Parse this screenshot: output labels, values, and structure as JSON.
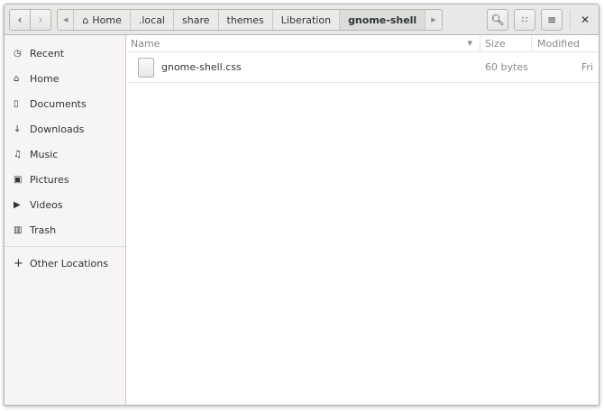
{
  "breadcrumbs": [
    "Home",
    ".local",
    "share",
    "themes",
    "Liberation",
    "gnome-shell"
  ],
  "sidebar": {
    "items": [
      {
        "label": "Recent",
        "icon": "clock-icon"
      },
      {
        "label": "Home",
        "icon": "home-icon"
      },
      {
        "label": "Documents",
        "icon": "document-icon"
      },
      {
        "label": "Downloads",
        "icon": "download-icon"
      },
      {
        "label": "Music",
        "icon": "music-icon"
      },
      {
        "label": "Pictures",
        "icon": "camera-icon"
      },
      {
        "label": "Videos",
        "icon": "video-icon"
      },
      {
        "label": "Trash",
        "icon": "trash-icon"
      }
    ],
    "other": "Other Locations"
  },
  "columns": {
    "name": "Name",
    "size": "Size",
    "modified": "Modified"
  },
  "files": [
    {
      "name": "gnome-shell.css",
      "size": "60 bytes",
      "modified": "Fri"
    }
  ]
}
